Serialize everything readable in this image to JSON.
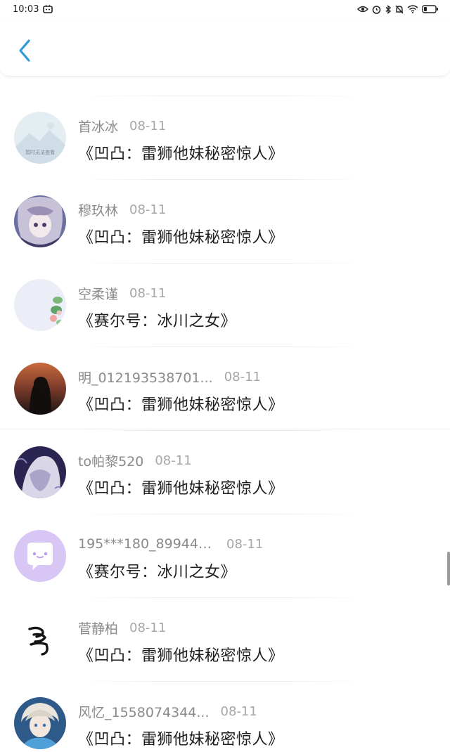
{
  "status": {
    "time": "10:03"
  },
  "items": [
    {
      "name": "首冰冰",
      "date": "08-11",
      "title": "《凹凸：雷狮他妹秘密惊人》",
      "avatar_text": "暂时无法查看"
    },
    {
      "name": "穆玖林",
      "date": "08-11",
      "title": "《凹凸：雷狮他妹秘密惊人》"
    },
    {
      "name": "空柔谨",
      "date": "08-11",
      "title": "《赛尔号：冰川之女》"
    },
    {
      "name": "明_012193538701...",
      "date": "08-11",
      "title": "《凹凸：雷狮他妹秘密惊人》"
    },
    {
      "name": "to帕黎520",
      "date": "08-11",
      "title": "《凹凸：雷狮他妹秘密惊人》"
    },
    {
      "name": "195***180_899443..",
      "date": "08-11",
      "title": "《赛尔号：冰川之女》"
    },
    {
      "name": "菅静柏",
      "date": "08-11",
      "title": "《凹凸：雷狮他妹秘密惊人》"
    },
    {
      "name": "风忆_1558074344...",
      "date": "08-11",
      "title": "《凹凸：雷狮他妹秘密惊人》"
    }
  ]
}
